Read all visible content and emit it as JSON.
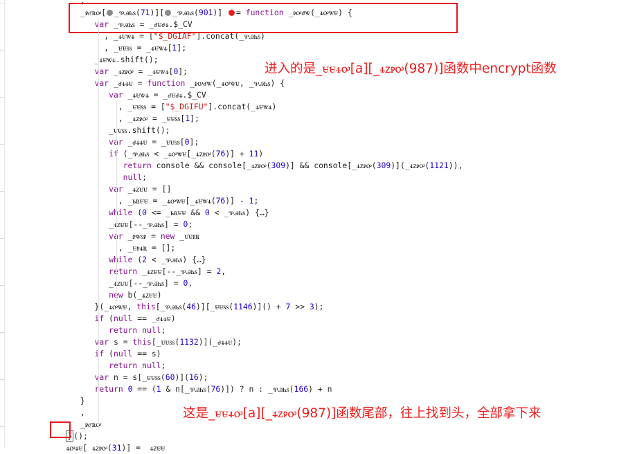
{
  "code_lines": [
    {
      "indent": 12,
      "text": ","
    },
    {
      "indent": 12,
      "parts": [
        {
          "t": "_ꭾꮄꮢꭴ["
        },
        {
          "bp": "grey"
        },
        {
          "t": "_ꮘꭿꮒꮪ("
        },
        {
          "n": "71"
        },
        {
          "t": ")]["
        },
        {
          "bp": "grey"
        },
        {
          "t": "_ꮘꭿꮒꮪ("
        },
        {
          "n": "901"
        },
        {
          "t": ")] "
        },
        {
          "bp": "red"
        },
        {
          "t": "= "
        },
        {
          "k": "function"
        },
        {
          "t": " _ꭾꭴꮷꮤ(_ꮞꭴꮤꮜ) {"
        }
      ]
    },
    {
      "indent": 15,
      "parts": [
        {
          "k": "var"
        },
        {
          "t": " _ꮘꭿꮒꮪ = _ꮷꮜꮷꮞ.$_CV"
        }
      ]
    },
    {
      "indent": 17,
      "parts": [
        {
          "t": ", _ꮞꮜꮤꮞ = ["
        },
        {
          "s": "\"$_DGIAF\""
        },
        {
          "t": "].concat(_ꮘꭿꮒꮪ)"
        }
      ]
    },
    {
      "indent": 17,
      "parts": [
        {
          "t": ", _ꮜꮜꮪꮪ = _ꮞꮜꮤꮞ["
        },
        {
          "n": "1"
        },
        {
          "t": "];"
        }
      ]
    },
    {
      "indent": 15,
      "parts": [
        {
          "t": "_ꮞꮜꮤꮞ.shift();"
        }
      ]
    },
    {
      "indent": 15,
      "parts": [
        {
          "k": "var"
        },
        {
          "t": " _ꮞꮓꭾꭴ = _ꮞꮜꮤꮞ["
        },
        {
          "n": "0"
        },
        {
          "t": "];"
        }
      ]
    },
    {
      "indent": 15,
      "parts": [
        {
          "k": "var"
        },
        {
          "t": " _ꮷꮞꮞꮜ = "
        },
        {
          "k": "function"
        },
        {
          "t": " _ꭾꭴꮷꮤ(_ꮞꭴꮤꮜ, _ꮘꭿꮒꮪ) {"
        }
      ]
    },
    {
      "indent": 18,
      "parts": [
        {
          "k": "var"
        },
        {
          "t": " _ꮞꮜꮤꮞ = _ꮷꮜꮷꮞ.$_CV"
        }
      ]
    },
    {
      "indent": 20,
      "parts": [
        {
          "t": ", _ꮜꮜꮪꮪ = ["
        },
        {
          "s": "\"$_DGIFU\""
        },
        {
          "t": "].concat(_ꮞꮜꮤꮞ)"
        }
      ]
    },
    {
      "indent": 20,
      "parts": [
        {
          "t": ", _ꮞꮓꭾꭴ = _ꮜꮜꮪꮪ["
        },
        {
          "n": "1"
        },
        {
          "t": "];"
        }
      ]
    },
    {
      "indent": 18,
      "parts": [
        {
          "t": "_ꮜꮜꮪꮪ.shift();"
        }
      ]
    },
    {
      "indent": 18,
      "parts": [
        {
          "k": "var"
        },
        {
          "t": " _ꮷꮞꮞꮜ = _ꮜꮜꮪꮪ["
        },
        {
          "n": "0"
        },
        {
          "t": "];"
        }
      ]
    },
    {
      "indent": 18,
      "parts": [
        {
          "k": "if"
        },
        {
          "t": " (_ꮘꭿꮒꮪ < _ꮞꭴꮤꮜ[_ꮞꮓꭾꭴ("
        },
        {
          "n": "76"
        },
        {
          "t": ")] + "
        },
        {
          "n": "11"
        },
        {
          "t": ")"
        }
      ]
    },
    {
      "indent": 21,
      "parts": [
        {
          "k": "return"
        },
        {
          "t": " console && console[_ꮞꮓꭾꭴ("
        },
        {
          "n": "309"
        },
        {
          "t": ")] && console[_ꮞꮓꭾꭴ("
        },
        {
          "n": "309"
        },
        {
          "t": ")](_ꮞꮓꭾꭴ("
        },
        {
          "n": "1121"
        },
        {
          "t": ")),"
        }
      ]
    },
    {
      "indent": 21,
      "parts": [
        {
          "k": "null"
        },
        {
          "t": ";"
        }
      ]
    },
    {
      "indent": 18,
      "parts": [
        {
          "k": "var"
        },
        {
          "t": " _ꮞꮓꮜꮜ = []"
        }
      ]
    },
    {
      "indent": 20,
      "parts": [
        {
          "t": ", _ꮟꮢꮜꮜ = _ꮞꭴꮤꮜ[_ꮞꮜꮤꮞ("
        },
        {
          "n": "76"
        },
        {
          "t": ")] - "
        },
        {
          "n": "1"
        },
        {
          "t": ";"
        }
      ]
    },
    {
      "indent": 18,
      "parts": [
        {
          "k": "while"
        },
        {
          "t": " ("
        },
        {
          "n": "0"
        },
        {
          "t": " <= _ꮟꮢꮜꮜ && "
        },
        {
          "n": "0"
        },
        {
          "t": " < _ꮘꭿꮒꮪ) {…}"
        }
      ]
    },
    {
      "indent": 18,
      "parts": [
        {
          "t": "_ꮞꮓꮜꮜ[--_ꮘꭿꮒꮪ] = "
        },
        {
          "n": "0"
        },
        {
          "t": ";"
        }
      ]
    },
    {
      "indent": 18,
      "parts": [
        {
          "k": "var"
        },
        {
          "t": " _ꭾꮤꮪꭾ = "
        },
        {
          "k": "new"
        },
        {
          "t": " _ꮜꮜꭾꮢ"
        }
      ]
    },
    {
      "indent": 20,
      "parts": [
        {
          "t": ", _ꮜꭾꮞꮢ = [];"
        }
      ]
    },
    {
      "indent": 18,
      "parts": [
        {
          "k": "while"
        },
        {
          "t": " ("
        },
        {
          "n": "2"
        },
        {
          "t": " < _ꮘꭿꮒꮪ) {…}"
        }
      ]
    },
    {
      "indent": 18,
      "parts": [
        {
          "k": "return"
        },
        {
          "t": " _ꮞꮓꮜꮜ[--_ꮘꭿꮒꮪ] = "
        },
        {
          "n": "2"
        },
        {
          "t": ","
        }
      ]
    },
    {
      "indent": 18,
      "parts": [
        {
          "t": "_ꮞꮓꮜꮜ[--_ꮘꭿꮒꮪ] = "
        },
        {
          "n": "0"
        },
        {
          "t": ","
        }
      ]
    },
    {
      "indent": 18,
      "parts": [
        {
          "k": "new"
        },
        {
          "t": " b(_ꮞꮓꮜꮜ)"
        }
      ]
    },
    {
      "indent": 15,
      "parts": [
        {
          "t": "}(_ꮞꭴꮤꮜ, "
        },
        {
          "k": "this"
        },
        {
          "t": "[_ꮘꭿꮒꮪ("
        },
        {
          "n": "46"
        },
        {
          "t": ")][_ꮜꮜꮪꮪ("
        },
        {
          "n": "1146"
        },
        {
          "t": ")]() + "
        },
        {
          "n": "7"
        },
        {
          "t": " >> "
        },
        {
          "n": "3"
        },
        {
          "t": ");"
        }
      ]
    },
    {
      "indent": 15,
      "parts": [
        {
          "k": "if"
        },
        {
          "t": " ("
        },
        {
          "k": "null"
        },
        {
          "t": " == _ꮷꮞꮞꮜ)"
        }
      ]
    },
    {
      "indent": 18,
      "parts": [
        {
          "k": "return null"
        },
        {
          "t": ";"
        }
      ]
    },
    {
      "indent": 15,
      "parts": [
        {
          "k": "var"
        },
        {
          "t": " s = "
        },
        {
          "k": "this"
        },
        {
          "t": "[_ꮜꮜꮪꮪ("
        },
        {
          "n": "1132"
        },
        {
          "t": ")](_ꮷꮞꮞꮜ);"
        }
      ]
    },
    {
      "indent": 15,
      "parts": [
        {
          "k": "if"
        },
        {
          "t": " ("
        },
        {
          "k": "null"
        },
        {
          "t": " == s)"
        }
      ]
    },
    {
      "indent": 18,
      "parts": [
        {
          "k": "return null"
        },
        {
          "t": ";"
        }
      ]
    },
    {
      "indent": 15,
      "parts": [
        {
          "k": "var"
        },
        {
          "t": " n = s[_ꮜꮜꮪꮪ("
        },
        {
          "n": "60"
        },
        {
          "t": ")]("
        },
        {
          "n": "16"
        },
        {
          "t": ");"
        }
      ]
    },
    {
      "indent": 15,
      "parts": [
        {
          "k": "return"
        },
        {
          "t": " "
        },
        {
          "n": "0"
        },
        {
          "t": " == ("
        },
        {
          "n": "1"
        },
        {
          "t": " & n[_ꮘꭿꮒꮪ("
        },
        {
          "n": "76"
        },
        {
          "t": ")]) ? n : _ꮘꭿꮒꮪ("
        },
        {
          "n": "166"
        },
        {
          "t": ") + n"
        }
      ]
    },
    {
      "indent": 12,
      "parts": [
        {
          "t": "}"
        }
      ]
    },
    {
      "indent": 12,
      "parts": [
        {
          "t": ","
        }
      ]
    },
    {
      "indent": 12,
      "parts": [
        {
          "t": "_ꭾꮄꮢꭴ"
        }
      ]
    },
    {
      "indent": 9,
      "parts": [
        {
          "caret": "}"
        },
        {
          "t": "();"
        }
      ]
    },
    {
      "indent": 9,
      "parts": [
        {
          "t": "ꮞꭴꮞꮜ[ ꮞꮓꭾꭴ("
        },
        {
          "n": "31"
        },
        {
          "t": ")] =  ꮞꮓꮜꮜ"
        }
      ]
    }
  ],
  "annotations": {
    "top": "进入的是_ꮜꮜꮞꭴ[a][_ꮞꮓꭾꭴ(987)]函数中encrypt函数",
    "bottom": "这是_ꮜꮜꮞꭴ[a][_ꮞꮓꭾꭴ(987)]函数尾部，往上找到头，全部拿下来"
  },
  "colors": {
    "keyword": "#881391",
    "number": "#1c00cf",
    "string": "#c41a16",
    "annotation": "#f01c1c",
    "breakpoint": "#e3221b"
  }
}
